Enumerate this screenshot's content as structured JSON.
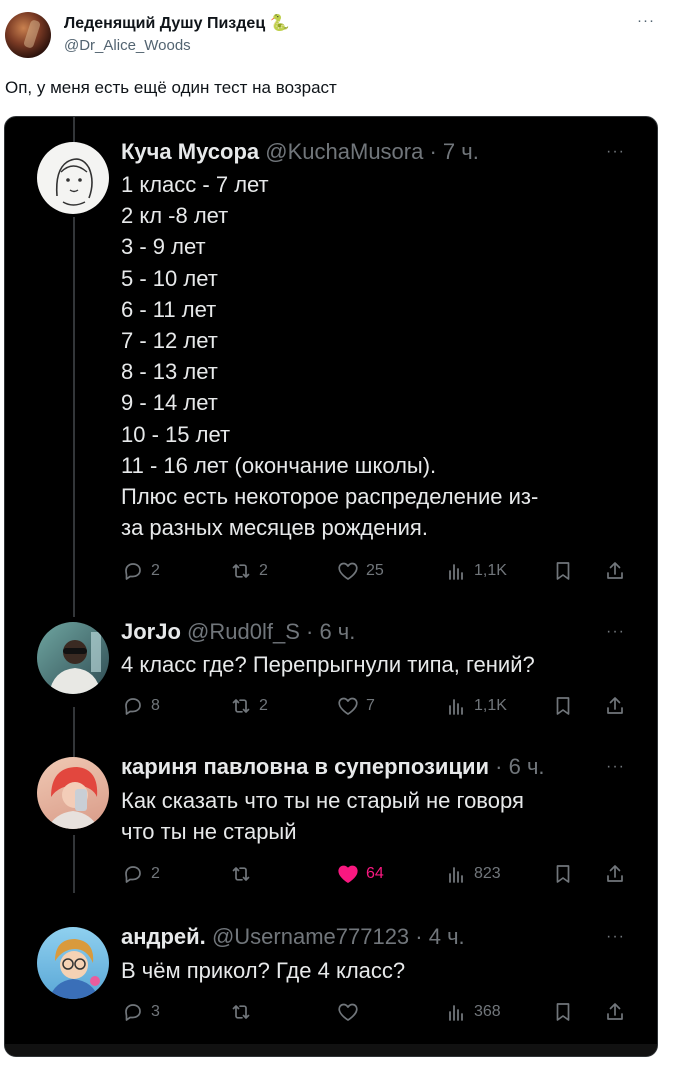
{
  "outer_post": {
    "author_name": "Леденящий Душу Пиздец 🐍",
    "author_handle": "@Dr_Alice_Woods",
    "more_label": "···",
    "text": "Оп, у меня есть ещё один тест на возраст"
  },
  "thread": [
    {
      "name": "Куча Мусора",
      "handle": "@KuchaMusora",
      "time": "· 7 ч.",
      "more": "···",
      "lines": [
        "1 класс - 7 лет",
        "2 кл -8 лет",
        "3 - 9 лет",
        "5 - 10 лет",
        "6 - 11 лет",
        "7 - 12 лет",
        "8 - 13 лет",
        "9 - 14 лет",
        "10 - 15 лет",
        "11 - 16 лет (окончание школы).",
        "Плюс есть некоторое распределение из-",
        "за разных месяцев рождения."
      ],
      "replies": "2",
      "reposts": "2",
      "likes": "25",
      "views": "1,1K",
      "liked": false
    },
    {
      "name": "JorJo",
      "handle": "@Rud0lf_S",
      "time": "· 6 ч.",
      "more": "···",
      "lines": [
        "4 класс где? Перепрыгнули типа, гений?"
      ],
      "replies": "8",
      "reposts": "2",
      "likes": "7",
      "views": "1,1K",
      "liked": false
    },
    {
      "name": "кариня павловна в суперпозиции",
      "handle": "",
      "time": "· 6 ч.",
      "more": "···",
      "lines": [
        "Как сказать что ты не старый не говоря",
        "что ты не старый"
      ],
      "replies": "2",
      "reposts": "",
      "likes": "64",
      "views": "823",
      "liked": true
    },
    {
      "name": "андрей.",
      "handle": "@Username777123",
      "time": "· 4 ч.",
      "more": "···",
      "lines": [
        "В чём прикол? Где 4 класс?"
      ],
      "replies": "3",
      "reposts": "",
      "likes": "",
      "views": "368",
      "liked": false
    }
  ],
  "colors": {
    "dark_bg": "#000000",
    "text_primary": "#e7e9ea",
    "text_secondary": "#71767b",
    "like_active": "#f91880"
  },
  "icons": {
    "reply": "reply-icon",
    "repost": "repost-icon",
    "like": "heart-icon",
    "views": "views-icon",
    "bookmark": "bookmark-icon",
    "share": "share-icon"
  }
}
